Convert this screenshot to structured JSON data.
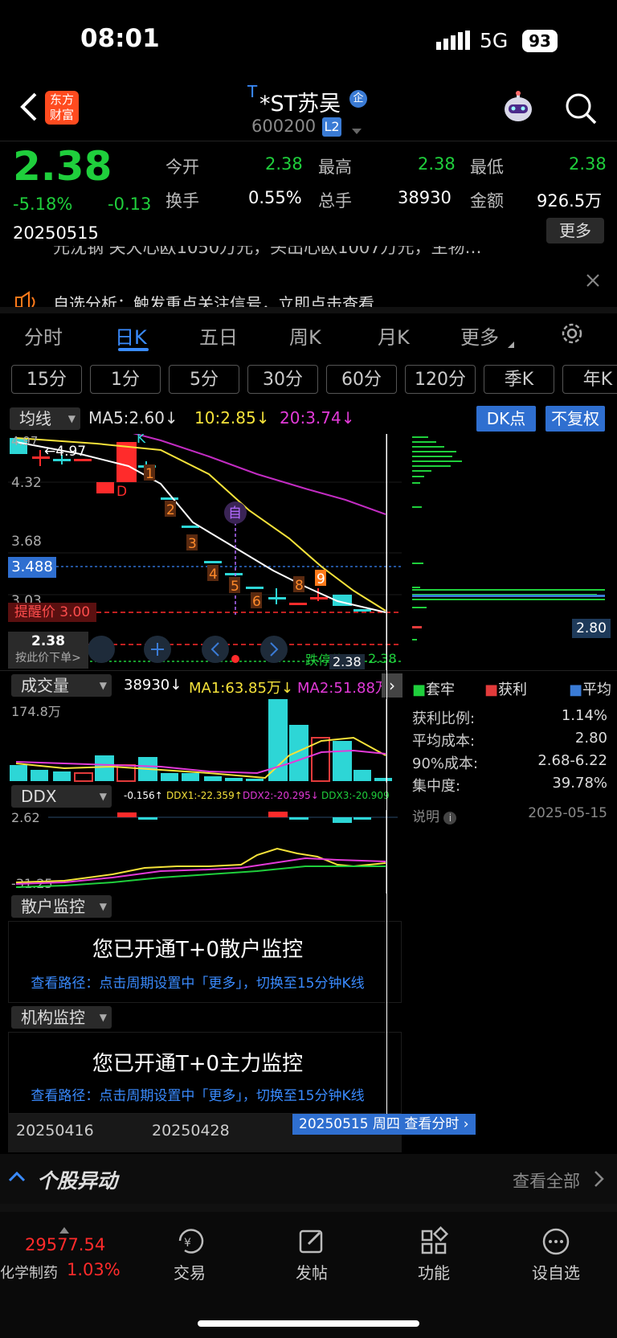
{
  "status_bar": {
    "time": "08:01",
    "network": "5G",
    "battery": "93"
  },
  "header": {
    "logo_line1": "东方",
    "logo_line2": "财富",
    "prefix": "T",
    "title": "*ST苏吴",
    "badge": "企",
    "code": "600200",
    "level": "L2"
  },
  "quote": {
    "price": "2.38",
    "change_pct": "-5.18%",
    "change": "-0.13",
    "date": "20250515",
    "more_label": "更多",
    "fields": [
      {
        "label": "今开",
        "value": "2.38",
        "color": "#1fcf3c"
      },
      {
        "label": "最高",
        "value": "2.38",
        "color": "#1fcf3c"
      },
      {
        "label": "最低",
        "value": "2.38",
        "color": "#1fcf3c"
      },
      {
        "label": "换手",
        "value": "0.55%",
        "color": "#ffffff"
      },
      {
        "label": "总手",
        "value": "38930",
        "color": "#ffffff"
      },
      {
        "label": "金额",
        "value": "926.5万",
        "color": "#ffffff"
      }
    ]
  },
  "notice": {
    "scroll_text": "元沈钢 关大心欧1050万元，头出心欧1007万元，生物…",
    "alert_text": "自选分析：触发重点关注信号，立即点击查看"
  },
  "period_tabs": [
    "分时",
    "日K",
    "五日",
    "周K",
    "月K",
    "更多"
  ],
  "active_tab": "日K",
  "intervals": [
    "15分",
    "1分",
    "5分",
    "30分",
    "60分",
    "120分",
    "季K",
    "年K"
  ],
  "ma_bar": {
    "selector": "均线",
    "ma5": "MA5:2.60↓",
    "ma10": "10:2.85↓",
    "ma20": "20:3.74↓",
    "dk_button": "DK点",
    "adjust_button": "不复权"
  },
  "kline": {
    "price_labels": [
      "4.97",
      "4.32",
      "3.68",
      "3.03"
    ],
    "high_label": "4.97",
    "current_price_label": "3.488",
    "alert_label": "提醒价 3.00",
    "order_price": "2.38",
    "order_hint": "按此价下单>",
    "limit_label": "跌停价",
    "limit_value": "2.38",
    "limit_price_tag": "2.38",
    "chip_price_tag": "2.80",
    "markers": [
      "D",
      "K",
      "1",
      "2",
      "3",
      "4",
      "5",
      "6",
      "7",
      "8",
      "9",
      "自"
    ]
  },
  "volume": {
    "selector": "成交量",
    "value": "38930↓",
    "ma1": "MA1:63.85万↓",
    "ma2": "MA2:51.88万",
    "max_label": "174.8万"
  },
  "chips": {
    "legend": [
      {
        "label": "套牢",
        "color": "#1fcf3c"
      },
      {
        "label": "获利",
        "color": "#e23b3b"
      },
      {
        "label": "平均",
        "color": "#3a7bd5"
      }
    ],
    "stats": [
      {
        "label": "获利比例:",
        "value": "1.14%"
      },
      {
        "label": "平均成本:",
        "value": "2.80"
      },
      {
        "label": "90%成本:",
        "value": "2.68-6.22"
      },
      {
        "label": "集中度:",
        "value": "39.78%"
      }
    ],
    "note_label": "说明",
    "note_date": "2025-05-15"
  },
  "ddx": {
    "selector": "DDX",
    "v0": "-0.156↑",
    "ddx1": "DDX1:-22.359↑",
    "ddx2": "DDX2:-20.295↓",
    "ddx3": "DDX3:-20.909↑",
    "top_label": "2.62",
    "bottom_label": "-31.25"
  },
  "retail_monitor": {
    "selector": "散户监控",
    "title": "您已开通T+0散户监控",
    "path": "查看路径：点击周期设置中「更多」，切换至15分钟K线"
  },
  "inst_monitor": {
    "selector": "机构监控",
    "title": "您已开通T+0主力监控",
    "path": "查看路径：点击周期设置中「更多」，切换至15分钟K线"
  },
  "dates": {
    "d1": "20250416",
    "d2": "20250428",
    "active": "20250515 周四 查看分时"
  },
  "movement": {
    "title": "个股异动",
    "view_all": "查看全部"
  },
  "bottom_nav": {
    "index_value": "29577.54",
    "index_name": "化学制药",
    "index_change": "1.03%",
    "items": [
      "交易",
      "发帖",
      "功能",
      "设自选"
    ]
  }
}
